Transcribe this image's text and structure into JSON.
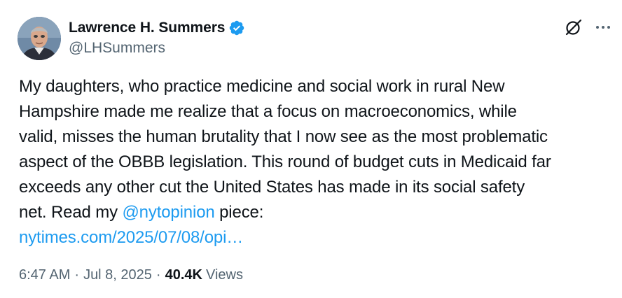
{
  "author": {
    "display_name": "Lawrence H. Summers",
    "handle": "@LHSummers",
    "verified": true
  },
  "tweet": {
    "lines": [
      [
        {
          "text": "My daughters, who practice medicine and social work in rural New"
        }
      ],
      [
        {
          "text": "Hampshire made me realize that a focus on macroeconomics, while"
        }
      ],
      [
        {
          "text": "valid, misses the human brutality that I now see as the most problematic"
        }
      ],
      [
        {
          "text": "aspect of the OBBB legislation. This round of budget cuts in Medicaid far"
        }
      ],
      [
        {
          "text": "exceeds any other cut the United States has made in its social safety"
        }
      ],
      [
        {
          "text": "net. Read my "
        },
        {
          "text": "@nytopinion",
          "link": true
        },
        {
          "text": " piece:"
        }
      ],
      [
        {
          "text": "nytimes.com/2025/07/08/opi…",
          "link": true
        }
      ]
    ]
  },
  "meta": {
    "time": "6:47 AM",
    "separator": "·",
    "date": "Jul 8, 2025",
    "views_count": "40.4K",
    "views_label": "Views"
  },
  "icons": {
    "verified": "verified-badge-icon",
    "grok": "grok-icon",
    "more": "more-options-icon"
  },
  "colors": {
    "text": "#0f1419",
    "secondary": "#536471",
    "link": "#1d9bf0",
    "verified": "#1d9bf0"
  }
}
